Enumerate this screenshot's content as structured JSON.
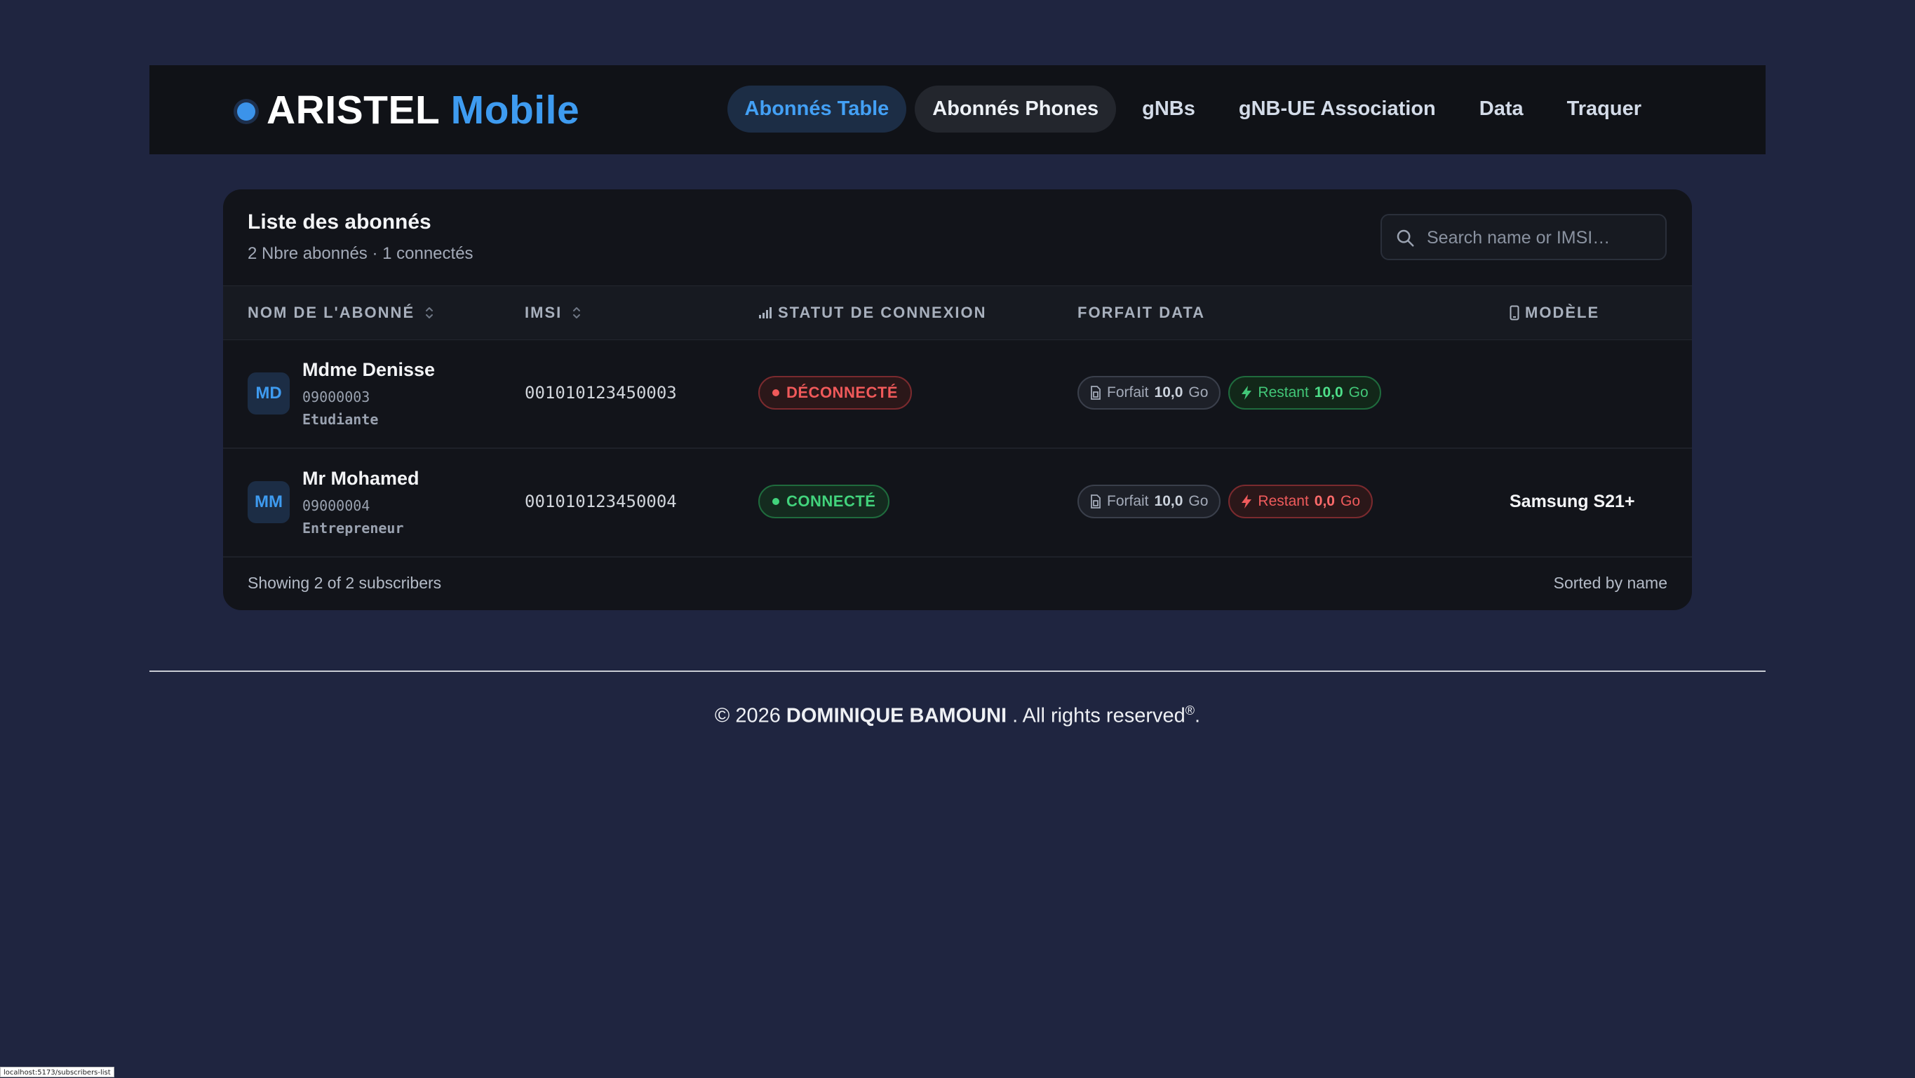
{
  "brand": {
    "name": "ARISTEL",
    "accent": "Mobile"
  },
  "nav": [
    {
      "label": "Abonnés Table",
      "state": "active"
    },
    {
      "label": "Abonnés Phones",
      "state": "hover"
    },
    {
      "label": "gNBs",
      "state": "normal"
    },
    {
      "label": "gNB-UE Association",
      "state": "normal"
    },
    {
      "label": "Data",
      "state": "normal"
    },
    {
      "label": "Traquer",
      "state": "normal"
    }
  ],
  "card": {
    "title": "Liste des abonnés",
    "subtitle": "2 Nbre abonnés · 1 connectés",
    "search_placeholder": "Search name or IMSI…",
    "columns": {
      "name": "NOM DE L'ABONNÉ",
      "imsi": "IMSI",
      "status": "STATUT DE CONNEXION",
      "forfait": "FORFAIT DATA",
      "model": "MODÈLE"
    },
    "rows": [
      {
        "initials": "MD",
        "name": "Mdme Denisse",
        "msisdn": "09000003",
        "profession": "Etudiante",
        "imsi": "001010123450003",
        "status": "DÉCONNECTÉ",
        "status_type": "off",
        "forfait_label": "Forfait",
        "forfait_value": "10,0",
        "forfait_unit": "Go",
        "restant_label": "Restant",
        "restant_value": "10,0",
        "restant_unit": "Go",
        "restant_type": "rest-ok",
        "model": ""
      },
      {
        "initials": "MM",
        "name": "Mr Mohamed",
        "msisdn": "09000004",
        "profession": "Entrepreneur",
        "imsi": "001010123450004",
        "status": "CONNECTÉ",
        "status_type": "on",
        "forfait_label": "Forfait",
        "forfait_value": "10,0",
        "forfait_unit": "Go",
        "restant_label": "Restant",
        "restant_value": "0,0",
        "restant_unit": "Go",
        "restant_type": "rest-low",
        "model": "Samsung S21+"
      }
    ],
    "footer_left": "Showing 2 of 2 subscribers",
    "footer_right": "Sorted by name"
  },
  "footer": {
    "prefix": "© 2026",
    "author": "DOMINIQUE BAMOUNI",
    "suffix": ". All rights reserved",
    "mark": "®",
    "end": "."
  },
  "statusbar": "localhost:5173/subscribers-list",
  "colors": {
    "background": "#1f2540",
    "navbar": "#101217",
    "accent": "#3e9bf0",
    "connected": "#42d37c",
    "disconnected": "#f0595a"
  },
  "icons": {
    "brand": "status-dot-icon",
    "search": "search-icon",
    "sort": "sort-icon",
    "status_col": "signal-bars-icon",
    "model_col": "phone-icon",
    "forfait": "sim-card-icon",
    "restant": "lightning-icon"
  }
}
